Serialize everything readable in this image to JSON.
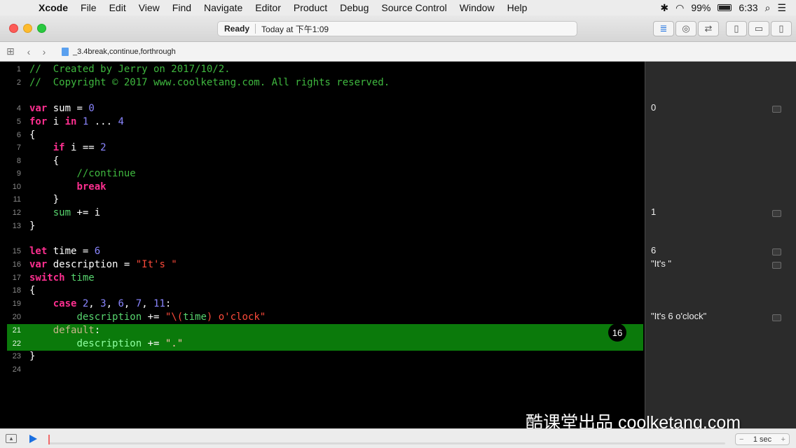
{
  "menubar": {
    "apple_glyph": "",
    "items": [
      "Xcode",
      "File",
      "Edit",
      "View",
      "Find",
      "Navigate",
      "Editor",
      "Product",
      "Debug",
      "Source Control",
      "Window",
      "Help"
    ],
    "battery": "99%",
    "time": "6:33"
  },
  "toolbar": {
    "status": "Ready",
    "timestamp": "Today at 下午1:09"
  },
  "jumpbar": {
    "filename": "_3.4break,continue,forthrough"
  },
  "code_lines": [
    {
      "n": "1"
    },
    {
      "n": "2"
    },
    {
      "n": "4"
    },
    {
      "n": "5"
    },
    {
      "n": "6"
    },
    {
      "n": "7"
    },
    {
      "n": "8"
    },
    {
      "n": "9"
    },
    {
      "n": "10"
    },
    {
      "n": "11"
    },
    {
      "n": "12"
    },
    {
      "n": "13"
    },
    {
      "n": "15"
    },
    {
      "n": "16"
    },
    {
      "n": "17"
    },
    {
      "n": "18"
    },
    {
      "n": "19"
    },
    {
      "n": "20"
    },
    {
      "n": "21"
    },
    {
      "n": "22"
    },
    {
      "n": "23"
    },
    {
      "n": "24"
    }
  ],
  "code": {
    "l1": "//  Created by Jerry on 2017/10/2.",
    "l2": "//  Copyright © 2017 www.coolketang.com. All rights reserved.",
    "l4_kw": "var",
    "l4_rest": " sum = ",
    "l4_num": "0",
    "l5_kw": "for",
    "l5_a": " i ",
    "l5_in": "in",
    "l5_n1": " 1",
    "l5_dots": " ... ",
    "l5_n2": "4",
    "brace_open": "{",
    "brace_close": "}",
    "l7_kw": "if",
    "l7_rest": " i == ",
    "l7_num": "2",
    "l9": "//continue",
    "l10": "break",
    "l12_id": "sum",
    "l12_rest": " += i",
    "l15_kw": "let",
    "l15_rest": " time = ",
    "l15_num": "6",
    "l16_kw": "var",
    "l16_rest": " description = ",
    "l16_str": "\"It's \"",
    "l17_kw": "switch",
    "l17_id": " time",
    "l19_kw": "case",
    "l19_n1": " 2",
    "l19_n2": " 3",
    "l19_n3": " 6",
    "l19_n4": " 7",
    "l19_n5": " 11",
    "comma": ",",
    "colon": ":",
    "l20_id": "description",
    "l20_op": " += ",
    "l20_s1": "\"\\(",
    "l20_time": "time",
    "l20_s2": ") o'clock\"",
    "l21_kw": "default",
    "l21_colon": ":",
    "l22_id": "description",
    "l22_op": " += ",
    "l22_str": "\".\""
  },
  "loop_badge": "16",
  "results": [
    "0",
    "1",
    "6",
    "\"It's \"",
    "\"It's 6 o'clock\""
  ],
  "watermark": "酷课堂出品 coolketang.com",
  "debugbar": {
    "duration": "1 sec",
    "minus": "−",
    "plus": "+"
  },
  "colors": {
    "keyword": "#fc2f8f",
    "comment": "#3fb83f",
    "number": "#8a86ff",
    "string": "#fc4a3a",
    "highlight": "#0b7a0b"
  }
}
